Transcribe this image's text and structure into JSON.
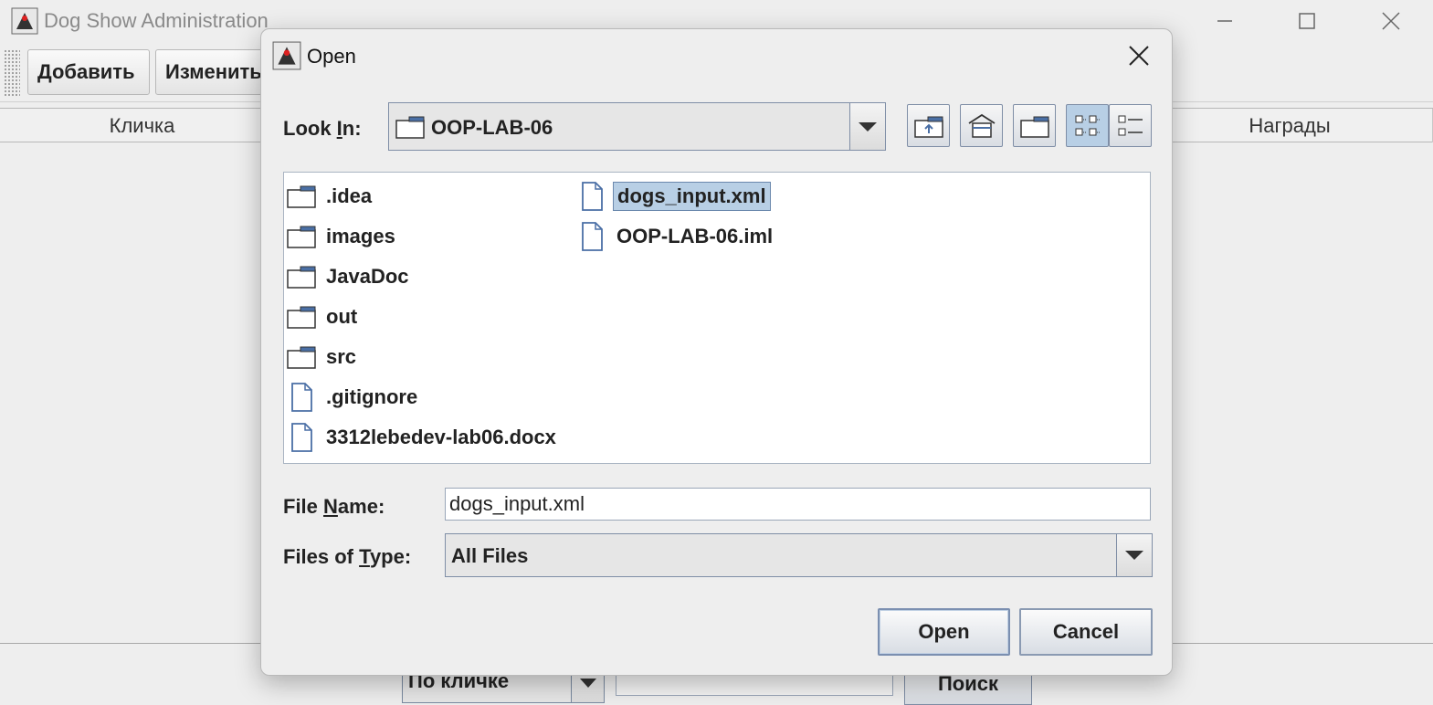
{
  "main_window": {
    "title": "Dog Show Administration",
    "toolbar": {
      "add_label": "Добавить",
      "edit_label": "Изменить"
    },
    "table_columns": [
      "Кличка",
      "Награды"
    ],
    "search": {
      "mode_value": "По кличке",
      "query": "",
      "button_label": "Поиск"
    },
    "window_controls": [
      "minimize-icon",
      "maximize-icon",
      "close-icon"
    ]
  },
  "dialog": {
    "title": "Open",
    "look_in": {
      "label_before": "Look ",
      "label_mnemonic": "I",
      "label_after": "n:",
      "value": "OOP-LAB-06"
    },
    "nav_buttons": [
      "up-one-level-icon",
      "home-icon",
      "new-folder-icon",
      "list-view-icon",
      "details-view-icon"
    ],
    "files": [
      {
        "name": ".idea",
        "type": "folder"
      },
      {
        "name": "images",
        "type": "folder"
      },
      {
        "name": "JavaDoc",
        "type": "folder"
      },
      {
        "name": "out",
        "type": "folder"
      },
      {
        "name": "src",
        "type": "folder"
      },
      {
        "name": ".gitignore",
        "type": "file"
      },
      {
        "name": "3312lebedev-lab06.docx",
        "type": "file"
      },
      {
        "name": "dogs_input.xml",
        "type": "file",
        "selected": true
      },
      {
        "name": "OOP-LAB-06.iml",
        "type": "file"
      }
    ],
    "file_name": {
      "label_before": "File ",
      "label_mnemonic": "N",
      "label_after": "ame:",
      "value": "dogs_input.xml"
    },
    "files_of_type": {
      "label_before": "Files of ",
      "label_mnemonic": "T",
      "label_after": "ype:",
      "value": "All Files"
    },
    "open_label": "Open",
    "cancel_label": "Cancel",
    "colors": {
      "selection": "#b8cfe5",
      "folder_blue": "#4a6fa5"
    }
  }
}
